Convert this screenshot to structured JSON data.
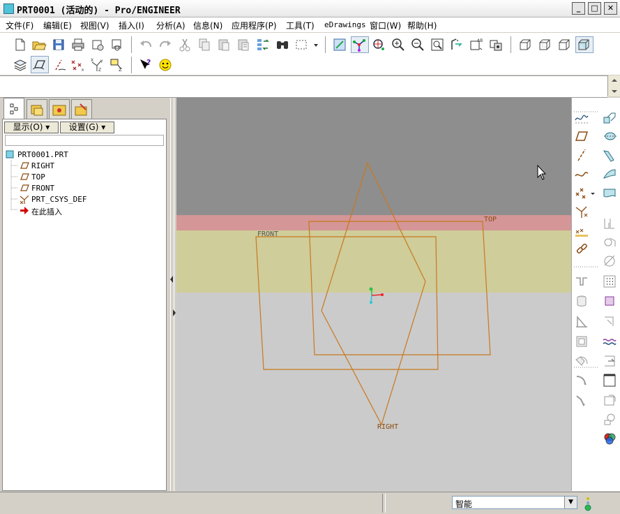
{
  "window": {
    "title": "PRT0001 (活动的) - Pro/ENGINEER",
    "min": "_",
    "max": "□",
    "close": "✕"
  },
  "menu": [
    "文件(F)",
    "编辑(E)",
    "视图(V)",
    "插入(I)",
    "分析(A)",
    "信息(N)",
    "应用程序(P)",
    "工具(T)",
    "eDrawings",
    "窗口(W)",
    "帮助(H)"
  ],
  "navigator": {
    "show_button": "显示(O) ▾",
    "settings_button": "设置(G) ▾",
    "tree": [
      {
        "label": "PRT0001.PRT",
        "icon": "part-icon"
      },
      {
        "label": "RIGHT",
        "icon": "datum-plane-icon"
      },
      {
        "label": "TOP",
        "icon": "datum-plane-icon"
      },
      {
        "label": "FRONT",
        "icon": "datum-plane-icon"
      },
      {
        "label": "PRT_CSYS_DEF",
        "icon": "csys-icon"
      },
      {
        "label": "在此插入",
        "icon": "insert-arrow-icon"
      }
    ]
  },
  "graphics": {
    "plane_labels": {
      "right": "RIGHT",
      "top": "TOP",
      "front": "FRONT"
    },
    "colors": {
      "upper_bg": "#8e8e8e",
      "pink_band": "#d49696",
      "yellow_band": "#cfcd9a",
      "lower_bg": "#cbcbcb",
      "datum": "#c8781e"
    }
  },
  "status": {
    "filter_value": "智能"
  }
}
